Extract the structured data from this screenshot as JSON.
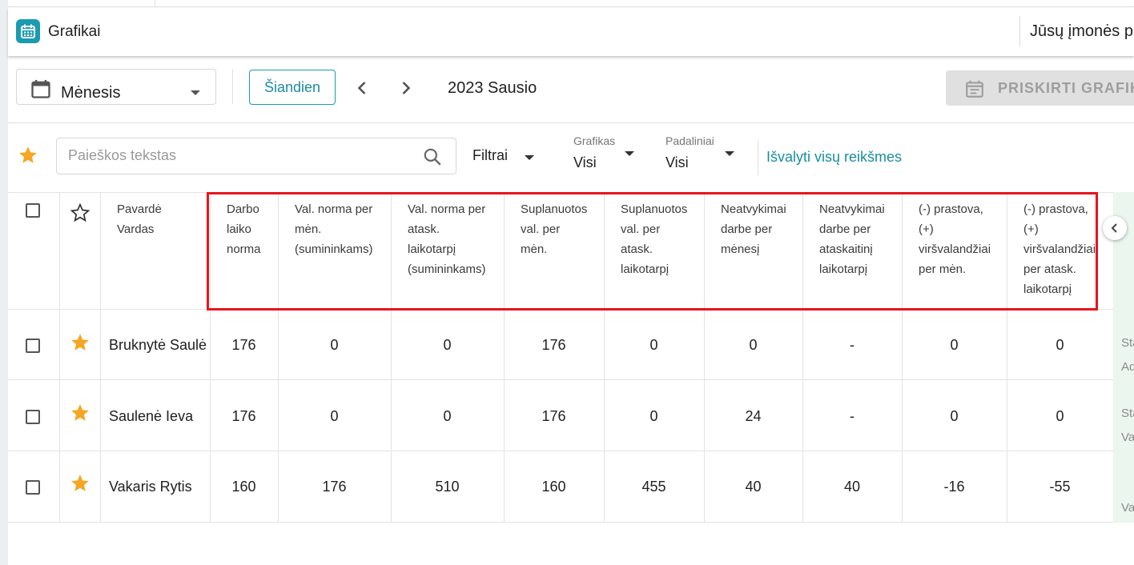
{
  "app": {
    "title": "Grafikai",
    "company": "Jūsų įmonės p"
  },
  "toolbar": {
    "view_mode": "Mėnesis",
    "today_label": "Šiandien",
    "period": "2023 Sausio",
    "assign_label": "PRISKIRTI GRAFIKĄ"
  },
  "filters": {
    "search_placeholder": "Paieškos tekstas",
    "filters_label": "Filtrai",
    "schedule_label": "Grafikas",
    "schedule_value": "Visi",
    "units_label": "Padaliniai",
    "units_value": "Visi",
    "clear_label": "Išvalyti visų reikšmes"
  },
  "table": {
    "name_header": [
      "Pavardė",
      "Vardas"
    ],
    "headers": [
      [
        "Darbo",
        "laiko",
        "norma"
      ],
      [
        "Val. norma per",
        "mėn.",
        "(sumininkams)"
      ],
      [
        "Val. norma per",
        "atask.",
        "laikotarpį",
        "(sumininkams)"
      ],
      [
        "Suplanuotos",
        "val. per",
        "mėn."
      ],
      [
        "Suplanuotos",
        "val. per",
        "atask.",
        "laikotarpį"
      ],
      [
        "Neatvykimai",
        "darbe per",
        "mėnesį"
      ],
      [
        "Neatvykimai",
        "darbe per",
        "ataskaitinį",
        "laikotarpį"
      ],
      [
        "(-) prastova,",
        "(+)",
        "viršvalandžiai",
        "per mėn."
      ],
      [
        "(-) prastova,",
        "(+)",
        "viršvalandžiai",
        "per atask.",
        "laikotarpį"
      ]
    ],
    "rows": [
      {
        "name": "Bruknytė Saulė",
        "values": [
          "176",
          "0",
          "0",
          "176",
          "0",
          "0",
          "-",
          "0",
          "0"
        ],
        "extra": [
          "Sta",
          "Ad"
        ]
      },
      {
        "name": "Saulenė Ieva",
        "values": [
          "176",
          "0",
          "0",
          "176",
          "0",
          "24",
          "-",
          "0",
          "0"
        ],
        "extra": [
          "Sta",
          "Va"
        ]
      },
      {
        "name": "Vakaris Rytis",
        "values": [
          "160",
          "176",
          "510",
          "160",
          "455",
          "40",
          "40",
          "-16",
          "-55"
        ],
        "extra": [
          "",
          "Va"
        ]
      }
    ]
  },
  "colors": {
    "accent": "#1a9bb0",
    "star": "#f5a623",
    "highlight": "#e8141e"
  }
}
